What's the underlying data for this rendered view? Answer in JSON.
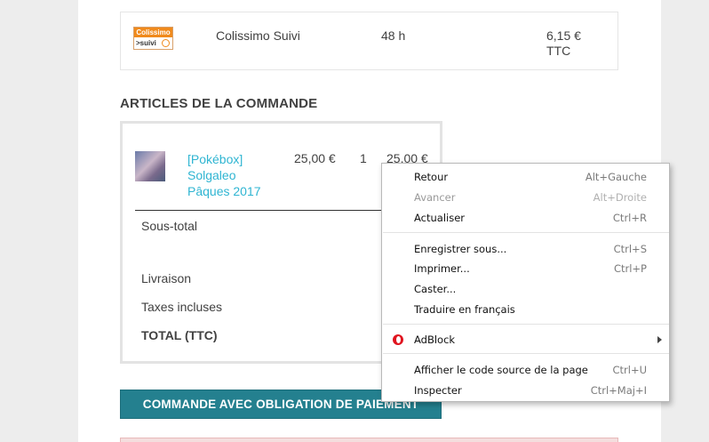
{
  "carrier": {
    "logo_top": "Colissimo",
    "logo_bottom": ">suivi",
    "name": "Colissimo Suivi",
    "delay": "48 h",
    "price": "6,15 €",
    "price_suffix": "TTC"
  },
  "order_items": {
    "title": "ARTICLES DE LA COMMANDE",
    "product": {
      "name_line1": "[Pokébox]",
      "name_line2": "Solgaleo",
      "name_line3": "Pâques 2017",
      "unit_price": "25,00 €",
      "quantity": "1",
      "total": "25,00 €"
    },
    "subtotal_label": "Sous-total",
    "shipping_label": "Livraison",
    "taxes_label": "Taxes incluses",
    "total_label": "TOTAL (TTC)"
  },
  "order_button_label": "COMMANDE AVEC OBLIGATION DE PAIEMENT",
  "context_menu": {
    "items": [
      {
        "label": "Retour",
        "shortcut": "Alt+Gauche"
      },
      {
        "label": "Avancer",
        "shortcut": "Alt+Droite"
      },
      {
        "label": "Actualiser",
        "shortcut": "Ctrl+R"
      },
      {
        "label": "Enregistrer sous...",
        "shortcut": "Ctrl+S"
      },
      {
        "label": "Imprimer...",
        "shortcut": "Ctrl+P"
      },
      {
        "label": "Caster...",
        "shortcut": ""
      },
      {
        "label": "Traduire en français",
        "shortcut": ""
      },
      {
        "label": "AdBlock",
        "shortcut": ""
      },
      {
        "label": "Afficher le code source de la page",
        "shortcut": "Ctrl+U"
      },
      {
        "label": "Inspecter",
        "shortcut": "Ctrl+Maj+I"
      }
    ]
  }
}
